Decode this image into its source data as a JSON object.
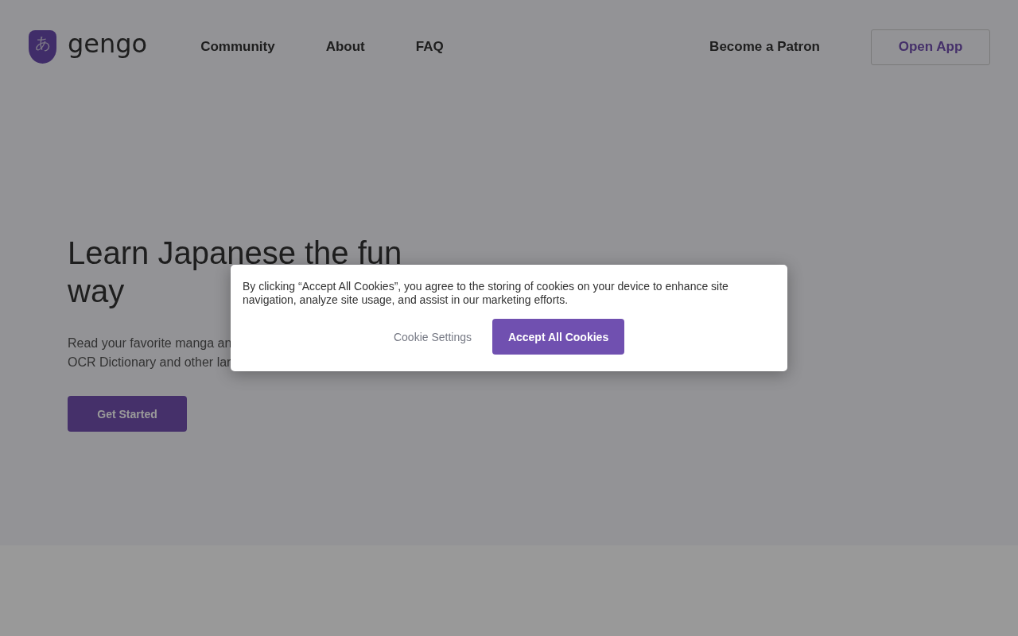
{
  "logo": {
    "glyph": "あ",
    "wordmark": "gengo"
  },
  "nav": {
    "links": [
      "Community",
      "About",
      "FAQ"
    ],
    "patron": "Become a Patron",
    "open_app": "Open App"
  },
  "hero": {
    "title_lines": [
      "Learn Japanese the fun",
      "way"
    ],
    "lines": [
      "Read your favorite manga an",
      "OCR Dictionary and other lar"
    ],
    "cta": "Get Started"
  },
  "cookie_banner": {
    "text": "By clicking “Accept All Cookies”, you agree to the storing of cookies on your device to enhance site navigation, analyze site usage, and assist in our marketing efforts.",
    "settings": "Cookie Settings",
    "accept": "Accept All Cookies"
  }
}
